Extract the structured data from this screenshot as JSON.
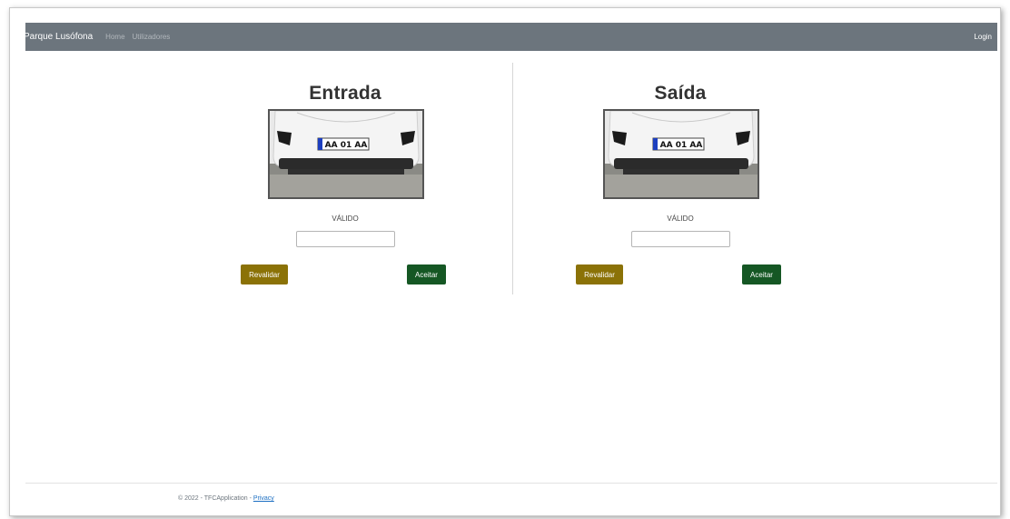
{
  "navbar": {
    "brand": "Parque Lusófona",
    "links": [
      "Home",
      "Utilizadores"
    ],
    "login": "Login"
  },
  "entrada": {
    "title": "Entrada",
    "plate": "AA 01 AA",
    "status": "VÁLIDO",
    "input_value": "",
    "revalidar_label": "Revalidar",
    "aceitar_label": "Aceitar"
  },
  "saida": {
    "title": "Saída",
    "plate": "AA 01 AA",
    "status": "VÁLIDO",
    "input_value": "",
    "revalidar_label": "Revalidar",
    "aceitar_label": "Aceitar"
  },
  "footer": {
    "text": "© 2022 - TFCApplication - ",
    "privacy": "Privacy"
  },
  "colors": {
    "navbar": "#6c757d",
    "revalidar": "#8b7207",
    "aceitar": "#155724"
  }
}
